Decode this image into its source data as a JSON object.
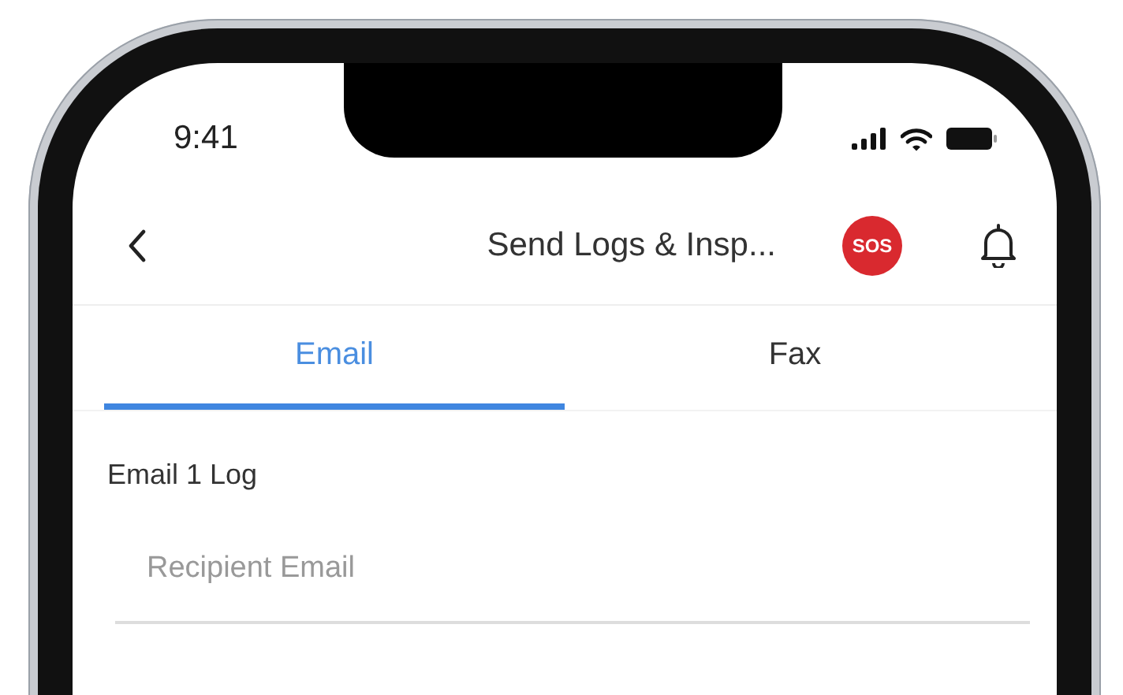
{
  "status_bar": {
    "time": "9:41"
  },
  "header": {
    "title": "Send Logs & Insp...",
    "sos_label": "SOS"
  },
  "tabs": [
    {
      "label": "Email",
      "selected": true
    },
    {
      "label": "Fax",
      "selected": false
    }
  ],
  "section_label": "Email 1 Log",
  "recipient_field": {
    "placeholder": "Recipient Email"
  }
}
